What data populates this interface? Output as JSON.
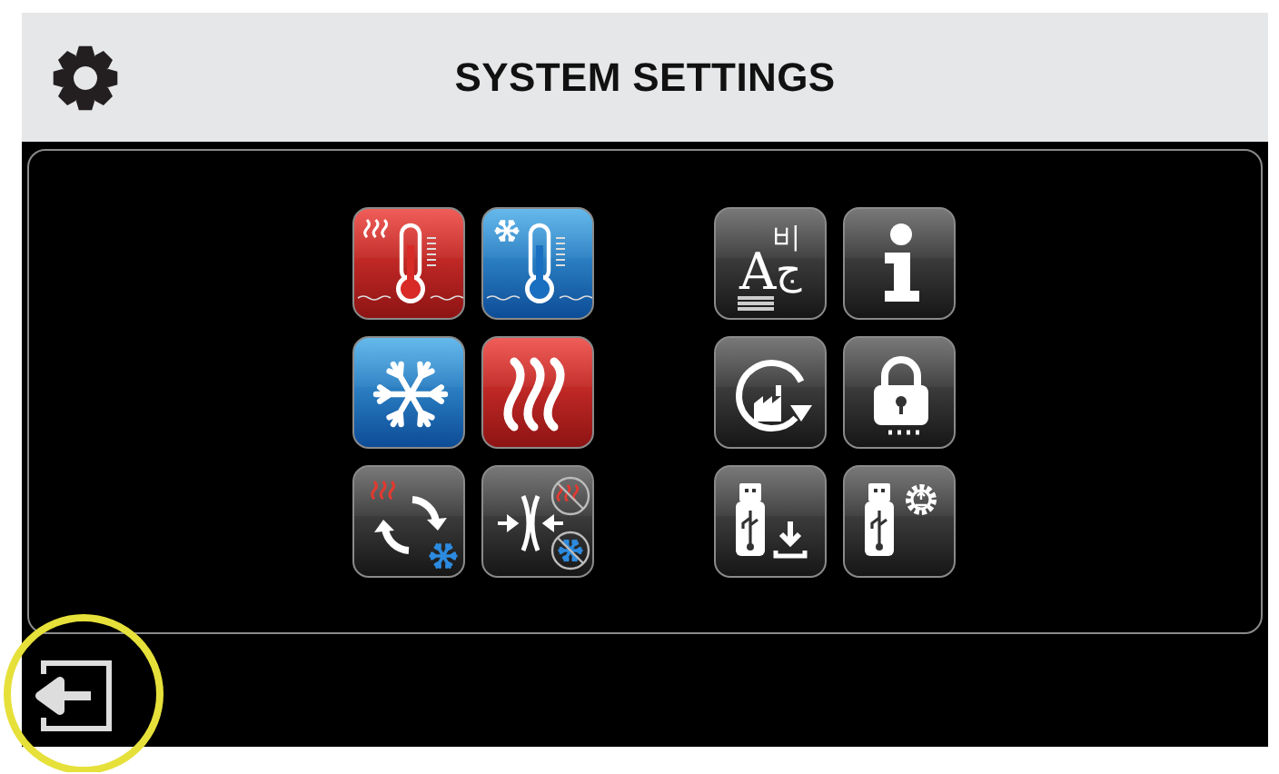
{
  "header": {
    "title": "SYSTEM SETTINGS"
  },
  "groups": [
    {
      "tiles": [
        {
          "kind": "heat-setpoint"
        },
        {
          "kind": "cool-setpoint"
        },
        {
          "kind": "cooling"
        },
        {
          "kind": "heating"
        },
        {
          "kind": "changeover"
        },
        {
          "kind": "deadband"
        }
      ]
    },
    {
      "tiles": [
        {
          "kind": "language",
          "glyphs": [
            "A",
            "비",
            "ج"
          ]
        },
        {
          "kind": "info"
        },
        {
          "kind": "factory-reset"
        },
        {
          "kind": "lock"
        },
        {
          "kind": "usb-download"
        },
        {
          "kind": "usb-settings"
        }
      ]
    }
  ]
}
